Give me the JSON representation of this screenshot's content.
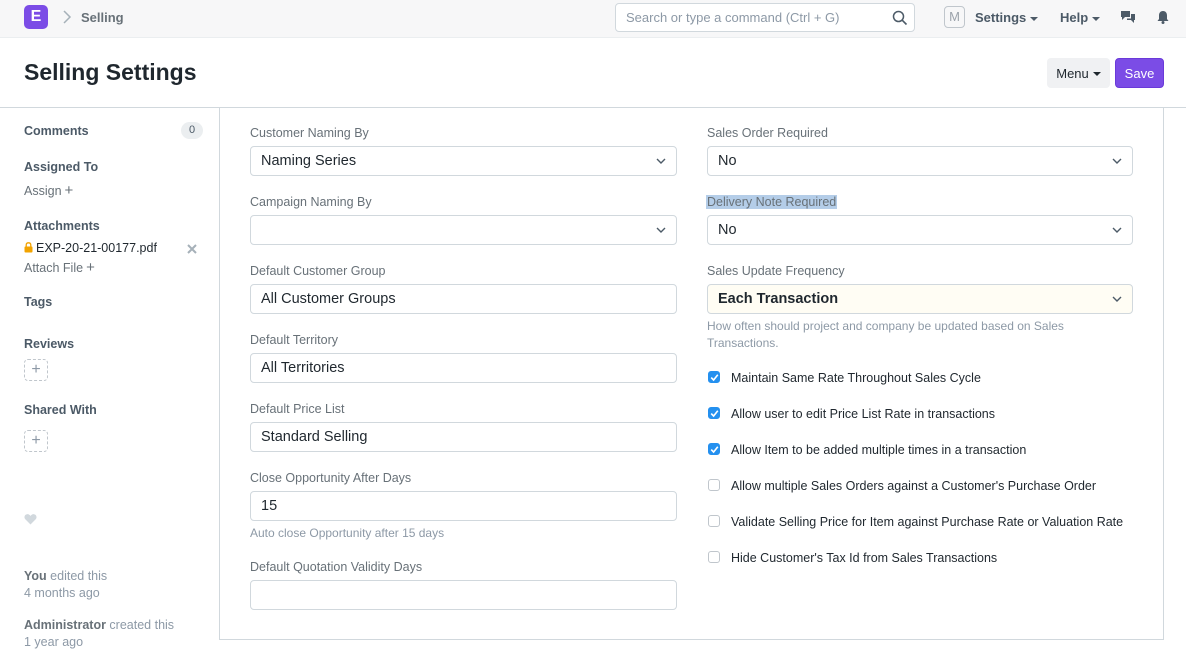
{
  "nav": {
    "logo": "E",
    "breadcrumb": "Selling",
    "search_placeholder": "Search or type a command (Ctrl + G)",
    "avatar": "M",
    "settings": "Settings",
    "help": "Help"
  },
  "page": {
    "title": "Selling Settings",
    "menu_label": "Menu",
    "save_label": "Save"
  },
  "sidebar": {
    "comments_label": "Comments",
    "comments_count": "0",
    "assigned_label": "Assigned To",
    "assign_link": "Assign",
    "attachments_label": "Attachments",
    "attachment_file": "EXP-20-21-00177.pdf",
    "attach_file_link": "Attach File",
    "tags_label": "Tags",
    "reviews_label": "Reviews",
    "shared_label": "Shared With",
    "add_symbol": "+",
    "timeline": [
      {
        "who": "You",
        "what": " edited this",
        "when": "4 months ago"
      },
      {
        "who": "Administrator",
        "what": " created this",
        "when": "1 year ago"
      }
    ]
  },
  "form": {
    "left": {
      "customer_naming": {
        "label": "Customer Naming By",
        "value": "Naming Series"
      },
      "campaign_naming": {
        "label": "Campaign Naming By",
        "value": ""
      },
      "customer_group": {
        "label": "Default Customer Group",
        "value": "All Customer Groups"
      },
      "territory": {
        "label": "Default Territory",
        "value": "All Territories"
      },
      "price_list": {
        "label": "Default Price List",
        "value": "Standard Selling"
      },
      "close_opportunity": {
        "label": "Close Opportunity After Days",
        "value": "15",
        "help": "Auto close Opportunity after 15 days"
      },
      "quotation_validity": {
        "label": "Default Quotation Validity Days",
        "value": ""
      }
    },
    "right": {
      "so_required": {
        "label": "Sales Order Required",
        "value": "No"
      },
      "dn_required": {
        "label": "Delivery Note Required",
        "value": "No"
      },
      "update_frequency": {
        "label": "Sales Update Frequency",
        "value": "Each Transaction",
        "help": "How often should project and company be updated based on Sales Transactions."
      }
    },
    "checkboxes": [
      {
        "label": "Maintain Same Rate Throughout Sales Cycle",
        "checked": true
      },
      {
        "label": "Allow user to edit Price List Rate in transactions",
        "checked": true
      },
      {
        "label": "Allow Item to be added multiple times in a transaction",
        "checked": true
      },
      {
        "label": "Allow multiple Sales Orders against a Customer's Purchase Order",
        "checked": false
      },
      {
        "label": "Validate Selling Price for Item against Purchase Rate or Valuation Rate",
        "checked": false
      },
      {
        "label": "Hide Customer's Tax Id from Sales Transactions",
        "checked": false
      }
    ]
  },
  "colors": {
    "accent": "#7b4ce6",
    "checkbox_on": "#2490ef"
  }
}
